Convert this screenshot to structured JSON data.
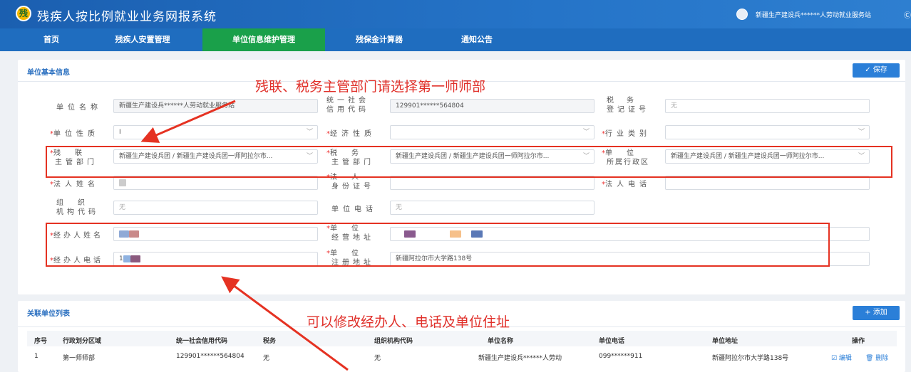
{
  "header": {
    "logo_char": "残",
    "title": "残疾人按比例就业业务网报系统",
    "user": "新疆生产建设兵******人劳动就业服务站",
    "exit": "Ⓒ"
  },
  "nav": [
    "首页",
    "残疾人安置管理",
    "单位信息维护管理",
    "残保金计算器",
    "通知公告"
  ],
  "basic": {
    "title": "单位基本信息",
    "save": "✓ 保存",
    "labels": {
      "unit_name": "单位名称",
      "credit_a": "统一社会",
      "credit_b": "信用代码",
      "tax_a": "税务",
      "tax_b": "登记证号",
      "unit_nature": "单位性质",
      "econ_nature": "经济性质",
      "industry": "行业类别",
      "dis_a": "残联",
      "dis_b": "主管部门",
      "taxdept_a": "税务",
      "taxdept_b": "主管部门",
      "region_a": "单位",
      "region_b": "所属行政区",
      "legal_name": "法人姓名",
      "legal_id_a": "法人",
      "legal_id_b": "身份证号",
      "legal_phone": "法人电话",
      "org_a": "组织",
      "org_b": "机构代码",
      "unit_phone": "单位电话",
      "agent_name": "经办人姓名",
      "biz_addr_a": "单位",
      "biz_addr_b": "经营地址",
      "agent_phone": "经办人电话",
      "reg_addr_a": "单位",
      "reg_addr_b": "注册地址"
    },
    "values": {
      "unit_name": "新疆生产建设兵******人劳动就业服务站",
      "credit_code": "129901******564804",
      "tax_reg": "无",
      "unit_nature": "I",
      "dis_dept": "新疆生产建设兵团 / 新疆生产建设兵团一师阿拉尔市...",
      "tax_dept": "新疆生产建设兵团 / 新疆生产建设兵团一师阿拉尔市...",
      "region": "新疆生产建设兵团 / 新疆生产建设兵团一师阿拉尔市...",
      "org_code": "无",
      "unit_phone": "无",
      "agent_phone_prefix": "1",
      "reg_addr": "新疆阿拉尔市大学路138号"
    }
  },
  "annotations": {
    "top": "残联、税务主管部门请选择第一师师部",
    "bottom": "可以修改经办人、电话及单位住址"
  },
  "related": {
    "title": "关联单位列表",
    "add": "+ 添加",
    "columns": [
      "序号",
      "行政划分区域",
      "统一社会信用代码",
      "税务",
      "组织机构代码",
      "单位名称",
      "单位电话",
      "单位地址",
      "操作"
    ],
    "row": {
      "no": "1",
      "region": "第一师师部",
      "credit": "129901******564804",
      "tax": "无",
      "org": "无",
      "name": "新疆生产建设兵******人劳动",
      "phone": "099******911",
      "addr": "新疆阿拉尔市大学路138号",
      "edit": "☑ 编辑",
      "del": "🗑 删除"
    }
  },
  "colors": {
    "header": "#1b5fb0",
    "nav": "#1f6dbf",
    "nav_active": "#1aa04a",
    "accent": "#2b7fd8",
    "annotation": "#e53222"
  }
}
